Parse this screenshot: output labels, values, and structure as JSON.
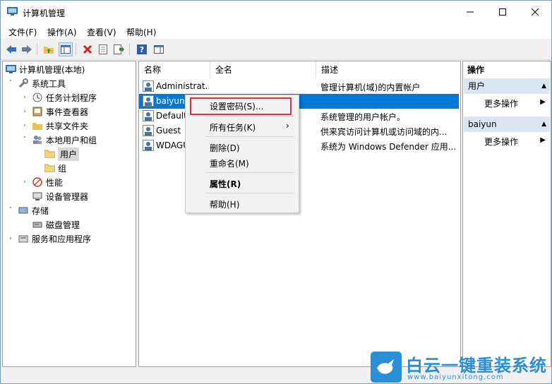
{
  "window": {
    "title": "计算机管理"
  },
  "menu": [
    "文件(F)",
    "操作(A)",
    "查看(V)",
    "帮助(H)"
  ],
  "tree": {
    "root": "计算机管理(本地)",
    "items": [
      {
        "label": "系统工具"
      },
      {
        "label": "任务计划程序"
      },
      {
        "label": "事件查看器"
      },
      {
        "label": "共享文件夹"
      },
      {
        "label": "本地用户和组"
      },
      {
        "label": "用户"
      },
      {
        "label": "组"
      },
      {
        "label": "性能"
      },
      {
        "label": "设备管理器"
      },
      {
        "label": "存储"
      },
      {
        "label": "磁盘管理"
      },
      {
        "label": "服务和应用程序"
      }
    ]
  },
  "list": {
    "columns": [
      "名称",
      "全名",
      "描述"
    ],
    "rows": [
      {
        "name": "Administrat...",
        "fullname": "",
        "desc": "管理计算机(域)的内置帐户"
      },
      {
        "name": "baiyun",
        "fullname": "",
        "desc": ""
      },
      {
        "name": "Default",
        "fullname": "",
        "desc": "系统管理的用户帐户。"
      },
      {
        "name": "Guest",
        "fullname": "",
        "desc": "供来宾访问计算机或访问域的内..."
      },
      {
        "name": "WDAGU",
        "fullname": "",
        "desc": "系统为 Windows Defender 应用..."
      }
    ]
  },
  "context_menu": {
    "items": [
      "设置密码(S)...",
      "所有任务(K)",
      "删除(D)",
      "重命名(M)",
      "属性(R)",
      "帮助(H)"
    ]
  },
  "actions": {
    "header": "操作",
    "sections": [
      {
        "title": "用户",
        "item": "更多操作"
      },
      {
        "title": "baiyun",
        "item": "更多操作"
      }
    ]
  },
  "watermark": {
    "text": "白云一键重装系统",
    "url": "www.baiyunxitong.com"
  },
  "colors": {
    "selection": "#0078d7",
    "highlight_box": "#e03040",
    "brand": "#2b8fd6"
  }
}
